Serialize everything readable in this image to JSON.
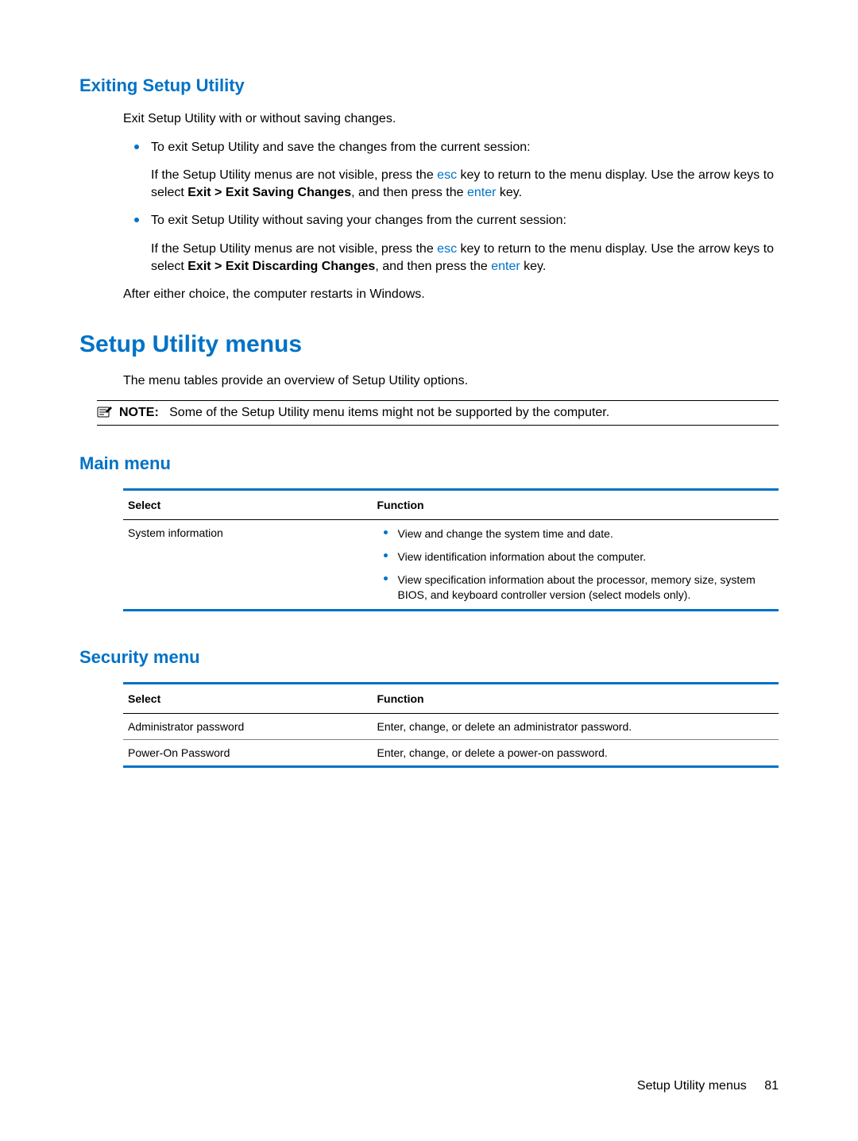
{
  "sections": {
    "exiting": {
      "heading": "Exiting Setup Utility",
      "intro": "Exit Setup Utility with or without saving changes.",
      "item1_text": "To exit Setup Utility and save the changes from the current session:",
      "item1_sub_a": "If the Setup Utility menus are not visible, press the ",
      "item1_sub_b": " key to return to the menu display. Use the arrow keys to select ",
      "item1_sub_bold": "Exit > Exit Saving Changes",
      "item1_sub_c": ", and then press the ",
      "item1_sub_d": " key.",
      "item2_text": "To exit Setup Utility without saving your changes from the current session:",
      "item2_sub_a": "If the Setup Utility menus are not visible, press the ",
      "item2_sub_b": " key to return to the menu display. Use the arrow keys to select ",
      "item2_sub_bold": "Exit > Exit Discarding Changes",
      "item2_sub_c": ", and then press the ",
      "item2_sub_d": " key.",
      "after": "After either choice, the computer restarts in Windows."
    },
    "menus": {
      "heading": "Setup Utility menus",
      "intro": "The menu tables provide an overview of Setup Utility options.",
      "note_label": "NOTE:",
      "note_text": "Some of the Setup Utility menu items might not be supported by the computer."
    },
    "main_menu": {
      "heading": "Main menu",
      "col_select": "Select",
      "col_function": "Function",
      "row1_select": "System information",
      "row1_fn1": "View and change the system time and date.",
      "row1_fn2": "View identification information about the computer.",
      "row1_fn3": "View specification information about the processor, memory size, system BIOS, and keyboard controller version (select models only)."
    },
    "security_menu": {
      "heading": "Security menu",
      "col_select": "Select",
      "col_function": "Function",
      "row1_select": "Administrator password",
      "row1_function": "Enter, change, or delete an administrator password.",
      "row2_select": "Power-On Password",
      "row2_function": "Enter, change, or delete a power-on password."
    },
    "keys": {
      "esc": "esc",
      "enter": "enter"
    }
  },
  "footer": {
    "section": "Setup Utility menus",
    "page": "81"
  }
}
